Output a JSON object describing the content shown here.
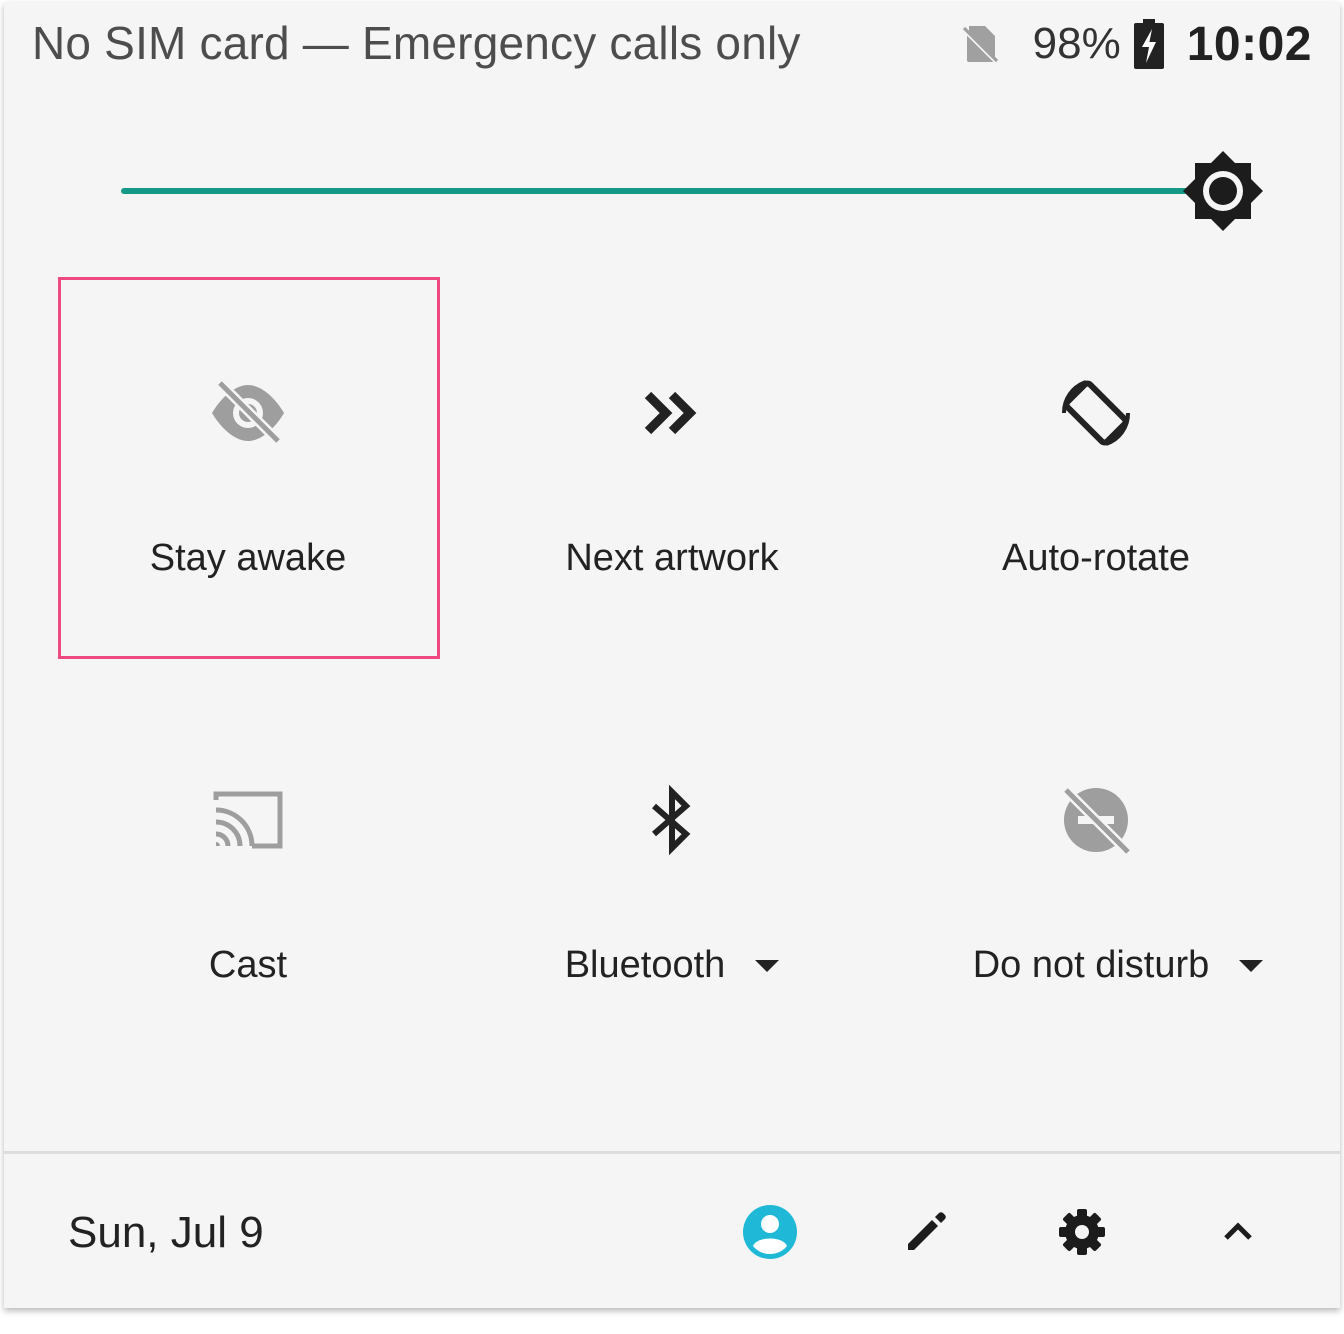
{
  "status_bar": {
    "carrier_text": "No SIM card — Emergency calls only",
    "battery_percent": "98%",
    "time": "10:02",
    "icons": [
      "no-sim-icon",
      "battery-charging-icon"
    ]
  },
  "brightness": {
    "level": 1.0,
    "accent_color": "#169887",
    "icon": "brightness-icon"
  },
  "tiles": [
    {
      "label": "Stay awake",
      "icon": "eye-off-icon",
      "state": "off",
      "highlighted": true
    },
    {
      "label": "Next artwork",
      "icon": "next-artwork-icon",
      "state": "on"
    },
    {
      "label": "Auto-rotate",
      "icon": "screen-rotation-icon",
      "state": "on"
    },
    {
      "label": "Cast",
      "icon": "cast-icon",
      "state": "off"
    },
    {
      "label": "Bluetooth",
      "icon": "bluetooth-icon",
      "state": "on",
      "has_dropdown": true
    },
    {
      "label": "Do not disturb",
      "icon": "do-not-disturb-off-icon",
      "state": "off",
      "has_dropdown": true
    }
  ],
  "footer": {
    "date": "Sun, Jul 9",
    "icons": [
      "account-icon",
      "edit-icon",
      "settings-gear-icon",
      "collapse-chevron-up-icon"
    ],
    "account_color": "#1fb8d6"
  },
  "colors": {
    "highlight_border": "#ee4a7f",
    "inactive_icon": "#9e9e9e",
    "active_icon": "#222222"
  }
}
